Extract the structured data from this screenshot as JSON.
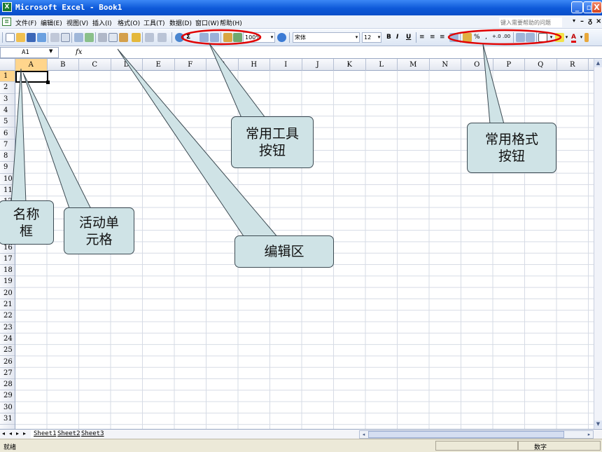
{
  "titlebar": {
    "app_icon": "excel-icon",
    "title": "Microsoft Excel - Book1",
    "buttons": [
      "minimize",
      "maximize",
      "close"
    ]
  },
  "menubar": {
    "items": [
      "文件(F)",
      "编辑(E)",
      "视图(V)",
      "插入(I)",
      "格式(O)",
      "工具(T)",
      "数据(D)",
      "窗口(W)",
      "帮助(H)"
    ],
    "help_placeholder": "键入需要帮助的问题"
  },
  "toolbar": {
    "zoom": "100%",
    "font_name": "宋体",
    "font_size": "12",
    "bold": "B",
    "italic": "I",
    "underline": "U",
    "percent": "%",
    "comma": ","
  },
  "formula_bar": {
    "name_box": "A1",
    "fx_label": "fx",
    "value": ""
  },
  "grid": {
    "columns": [
      "A",
      "B",
      "C",
      "D",
      "E",
      "F",
      "G",
      "H",
      "I",
      "J",
      "K",
      "L",
      "M",
      "N",
      "O",
      "P",
      "Q",
      "R"
    ],
    "rows": [
      "1",
      "2",
      "3",
      "4",
      "5",
      "6",
      "7",
      "8",
      "9",
      "10",
      "11",
      "12",
      "13",
      "14",
      "15",
      "16",
      "17",
      "18",
      "19",
      "20",
      "21",
      "22",
      "23",
      "24",
      "25",
      "26",
      "27",
      "28",
      "29",
      "30",
      "31"
    ],
    "active_cell": "A1"
  },
  "sheets": {
    "tabs": [
      "Sheet1",
      "Sheet2",
      "Sheet3"
    ],
    "active": "Sheet1"
  },
  "statusbar": {
    "left": "就绪",
    "right": "数字"
  },
  "annotations": {
    "name_box": "名称\n框",
    "active_cell": "活动单\n元格",
    "editing_area": "编辑区",
    "standard_toolbar": "常用工具\n按钮",
    "formatting_toolbar": "常用格式\n按钮"
  },
  "colors": {
    "titlebar": "#0d58d8",
    "callout_fill": "#cfe3e6",
    "highlight_ellipse": "#e00000",
    "selected_header": "#ffd58c"
  }
}
